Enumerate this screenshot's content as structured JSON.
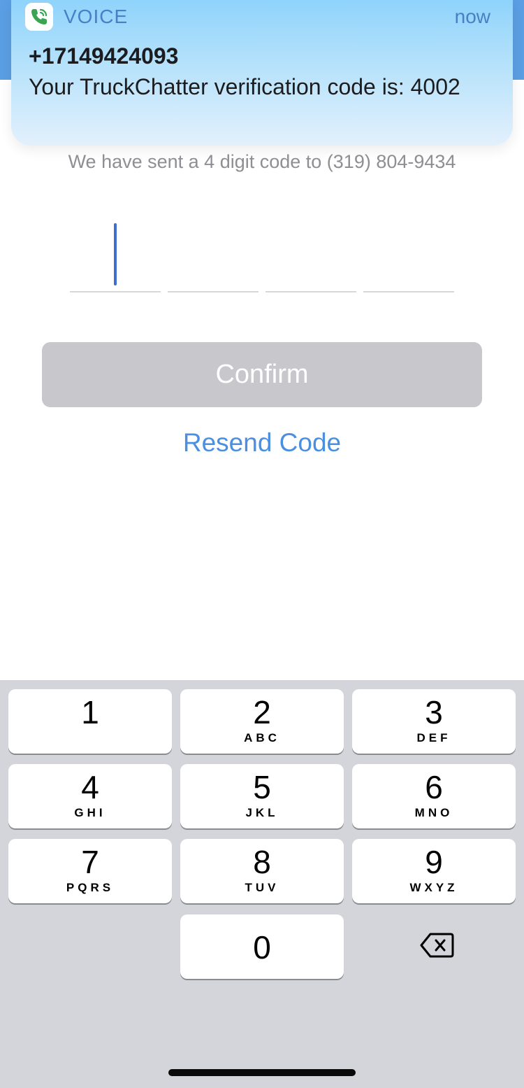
{
  "notification": {
    "app_name": "VOICE",
    "time": "now",
    "sender": "+17149424093",
    "message": "Your TruckChatter verification code is: 4002"
  },
  "verification": {
    "sent_text": "We have sent a 4 digit code to (319) 804-9434",
    "code_digits": [
      "",
      "",
      "",
      ""
    ],
    "confirm_label": "Confirm",
    "resend_label": "Resend Code"
  },
  "keypad": {
    "keys": [
      {
        "num": "1",
        "letters": ""
      },
      {
        "num": "2",
        "letters": "ABC"
      },
      {
        "num": "3",
        "letters": "DEF"
      },
      {
        "num": "4",
        "letters": "GHI"
      },
      {
        "num": "5",
        "letters": "JKL"
      },
      {
        "num": "6",
        "letters": "MNO"
      },
      {
        "num": "7",
        "letters": "PQRS"
      },
      {
        "num": "8",
        "letters": "TUV"
      },
      {
        "num": "9",
        "letters": "WXYZ"
      },
      {
        "num": "0",
        "letters": ""
      }
    ],
    "backspace_icon": "backspace-icon"
  },
  "colors": {
    "header": "#5b9ee3",
    "accent": "#4a8fe0",
    "cursor": "#3e6fd0",
    "disabled_button": "#c7c7cc"
  }
}
